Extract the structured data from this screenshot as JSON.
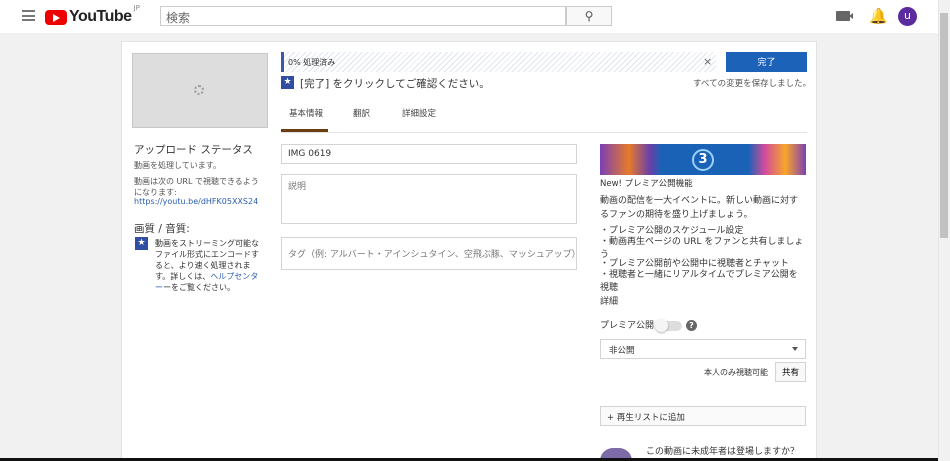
{
  "header": {
    "logo": "YouTube",
    "region": "JP",
    "search_placeholder": "検索",
    "avatar_letter": "u"
  },
  "upload": {
    "progress_text": "0% 処理済み",
    "progress_percent": 0,
    "done_label": "完了",
    "confirm_text": "[完了] をクリックしてご確認ください。",
    "saved_text": "すべての変更を保存しました。"
  },
  "tabs": [
    {
      "label": "基本情報",
      "active": true
    },
    {
      "label": "翻訳"
    },
    {
      "label": "詳細設定"
    }
  ],
  "status": {
    "title": "アップロード ステータス",
    "processing": "動画を処理しています。",
    "url_note": "動画は次の URL で視聴できるようになります:",
    "url": "https://youtu.be/dHFK05XXS24",
    "quality_title": "画質 / 音質:",
    "quality_text": "動画をストリーミング可能なファイル形式にエンコードすると、より速く処理されます。詳しくは、",
    "help_link": "ヘルプセンター",
    "quality_tail": "ーをご覧ください。"
  },
  "form": {
    "title_value": "IMG 0619",
    "description_placeholder": "説明",
    "tags_placeholder": "タグ（例: アルバート・アインシュタイン、空飛ぶ豚、マッシュアップ）"
  },
  "premiere": {
    "banner_number": "3",
    "heading": "New! プレミア公開機能",
    "intro": "動画の配信を一大イベントに。新しい動画に対するファンの期待を盛り上げましょう。",
    "bullets": [
      "・プレミア公開のスケジュール設定",
      "・動画再生ページの URL をファンと共有しましょう",
      "・プレミア公開前や公開中に視聴者とチャット",
      "・視聴者と一緒にリアルタイムでプレミア公開を視聴"
    ],
    "details_link": "詳細",
    "toggle_label": "プレミア公開",
    "toggle_on": false
  },
  "privacy": {
    "selected": "非公開",
    "note": "本人のみ視聴可能",
    "share_label": "共有",
    "playlist_label": "+ 再生リストに追加",
    "kids_question": "この動画に未成年者は登場しますか？"
  },
  "colors": {
    "accent": "#1c62b9",
    "brand": "#ee0000",
    "avatar": "#5b2a9e"
  }
}
